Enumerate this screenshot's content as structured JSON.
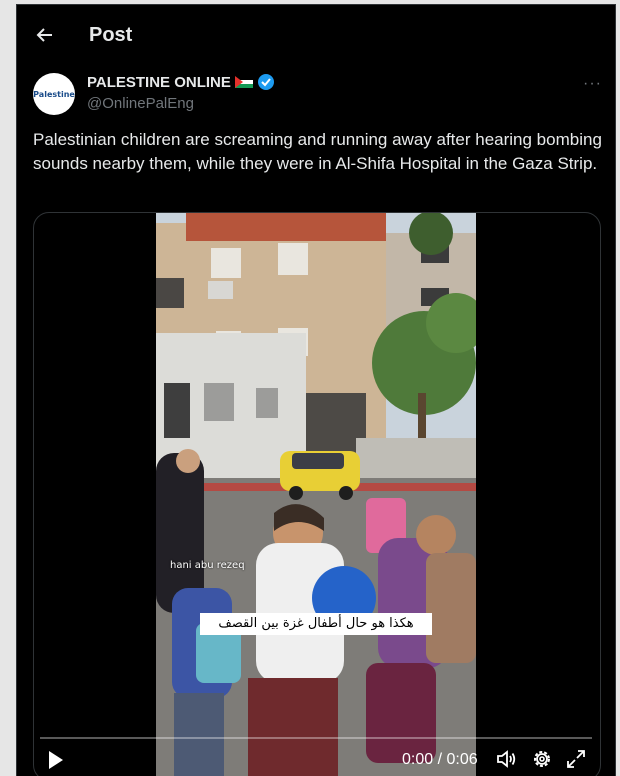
{
  "header": {
    "title": "Post"
  },
  "author": {
    "display_name": "PALESTINE ONLINE",
    "handle": "@OnlinePalEng",
    "avatar_text": "Palestine"
  },
  "post": {
    "text": "Palestinian children are screaming and running away after hearing bombing sounds nearby them, while they were in Al-Shifa Hospital in the Gaza Strip."
  },
  "video": {
    "watermark": "hani abu rezeq",
    "caption": "هكذا هو حال أطفال غزة بين القصف",
    "time": "0:00 / 0:06",
    "progress": 0
  },
  "colors": {
    "verified": "#1d9bf0",
    "background": "#000000",
    "muted": "#71767b"
  },
  "icons": {
    "back": "back-arrow-icon",
    "verified": "verified-badge-icon",
    "more": "more-icon",
    "play": "play-icon",
    "volume": "volume-icon",
    "settings": "gear-icon",
    "fullscreen": "fullscreen-icon"
  }
}
